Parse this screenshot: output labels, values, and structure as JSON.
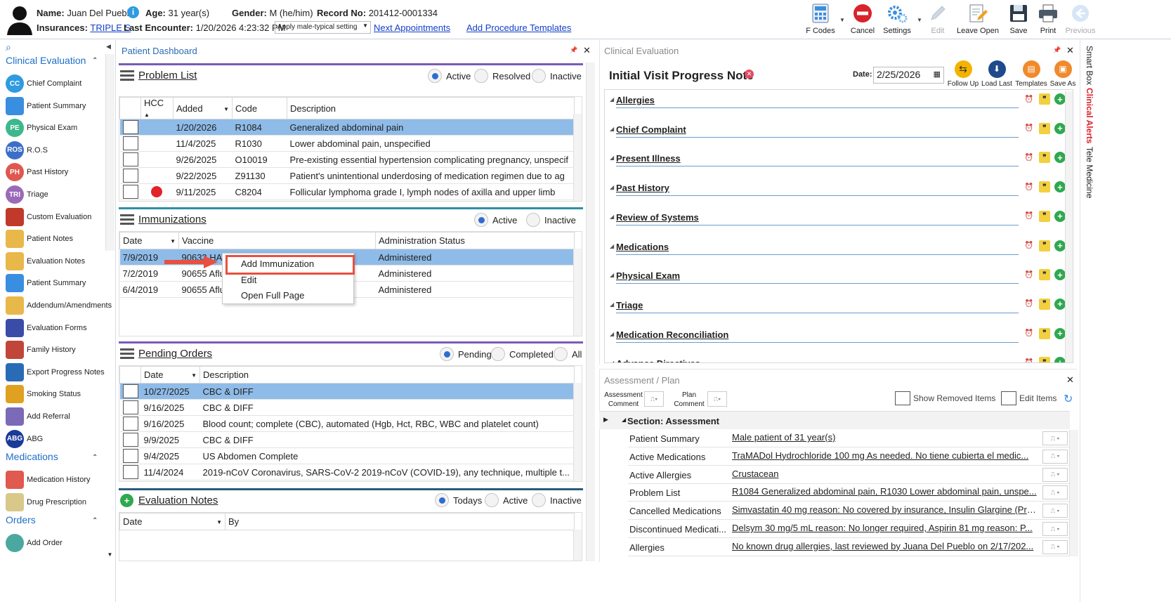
{
  "header": {
    "name_label": "Name:",
    "name_value": "Juan Del Pueblo",
    "age_label": "Age:",
    "age_value": "31 year(s)",
    "gender_label": "Gender:",
    "gender_value": "M (he/him)",
    "record_label": "Record No:",
    "record_value": "201412-0001334",
    "insurances_label": "Insurances:",
    "insurances_value": "TRIPLE S",
    "last_encounter_label": "Last Encounter:",
    "last_encounter_value": "1/20/2026 4:23:32 PM",
    "setting_select": "Apply male-typical setting",
    "next_appointments": "Next Appointments",
    "add_procedure_templates": "Add Procedure Templates"
  },
  "toolbar": {
    "fcodes": "F Codes",
    "cancel": "Cancel",
    "settings": "Settings",
    "edit": "Edit",
    "leave_open": "Leave Open",
    "save": "Save",
    "print": "Print",
    "previous": "Previous"
  },
  "nav": {
    "section_clinical": "Clinical Evaluation",
    "items_clinical": [
      {
        "label": "Chief Complaint",
        "badge": "CC"
      },
      {
        "label": "Patient Summary",
        "badge": ""
      },
      {
        "label": "Physical Exam",
        "badge": "PE"
      },
      {
        "label": "R.O.S",
        "badge": "ROS"
      },
      {
        "label": "Past History",
        "badge": "PH"
      },
      {
        "label": "Triage",
        "badge": "TRI"
      },
      {
        "label": "Custom Evaluation",
        "badge": ""
      },
      {
        "label": "Patient Notes",
        "badge": ""
      },
      {
        "label": "Evaluation Notes",
        "badge": ""
      },
      {
        "label": "Patient Summary",
        "badge": ""
      },
      {
        "label": "Addendum/Amendments",
        "badge": ""
      },
      {
        "label": "Evaluation Forms",
        "badge": ""
      },
      {
        "label": "Family History",
        "badge": ""
      },
      {
        "label": "Export Progress Notes",
        "badge": ""
      },
      {
        "label": "Smoking Status",
        "badge": ""
      },
      {
        "label": "Add Referral",
        "badge": ""
      },
      {
        "label": "ABG",
        "badge": "ABG"
      }
    ],
    "section_medications": "Medications",
    "items_medications": [
      {
        "label": "Medication History"
      },
      {
        "label": "Drug Prescription"
      }
    ],
    "section_orders": "Orders",
    "items_orders": [
      {
        "label": "Add Order"
      }
    ]
  },
  "dashboard": {
    "title": "Patient Dashboard",
    "problem_list": {
      "title": "Problem List",
      "filters": [
        "Active",
        "Resolved",
        "Inactive"
      ],
      "columns": [
        "HCC",
        "Added",
        "Code",
        "Description"
      ],
      "rows": [
        {
          "hcc": "",
          "added": "1/20/2026",
          "code": "R1084",
          "desc": "Generalized abdominal pain"
        },
        {
          "hcc": "",
          "added": "11/4/2025",
          "code": "R1030",
          "desc": "Lower abdominal pain, unspecified"
        },
        {
          "hcc": "",
          "added": "9/26/2025",
          "code": "O10019",
          "desc": "Pre-existing essential hypertension complicating pregnancy, unspecif"
        },
        {
          "hcc": "",
          "added": "9/22/2025",
          "code": "Z91130",
          "desc": "Patient's unintentional underdosing of medication regimen due to ag"
        },
        {
          "hcc": "red-dot",
          "added": "9/11/2025",
          "code": "C8204",
          "desc": "Follicular lymphoma grade I, lymph nodes of axilla and upper limb"
        }
      ]
    },
    "immunizations": {
      "title": "Immunizations",
      "filters": [
        "Active",
        "Inactive"
      ],
      "columns": [
        "Date",
        "Vaccine",
        "Administration Status"
      ],
      "rows": [
        {
          "date": "7/9/2019",
          "vaccine": "90633 HAV",
          "status": "Administered"
        },
        {
          "date": "7/2/2019",
          "vaccine": "90655 Aflu",
          "status": "Administered"
        },
        {
          "date": "6/4/2019",
          "vaccine": "90655 Aflu",
          "status": "Administered"
        }
      ]
    },
    "context_menu": [
      "Add Immunization",
      "Edit",
      "Open Full Page"
    ],
    "pending_orders": {
      "title": "Pending Orders",
      "filters": [
        "Pending",
        "Completed",
        "All"
      ],
      "columns": [
        "Date",
        "Description"
      ],
      "rows": [
        {
          "date": "10/27/2025",
          "desc": "CBC & DIFF"
        },
        {
          "date": "9/16/2025",
          "desc": "CBC & DIFF"
        },
        {
          "date": "9/16/2025",
          "desc": "Blood count; complete (CBC), automated (Hgb, Hct, RBC, WBC and platelet count)"
        },
        {
          "date": "9/9/2025",
          "desc": "CBC & DIFF"
        },
        {
          "date": "9/4/2025",
          "desc": "US Abdomen Complete"
        },
        {
          "date": "11/4/2024",
          "desc": "2019-nCoV Coronavirus, SARS-CoV-2 2019-nCoV (COVID-19), any technique, multiple t..."
        }
      ]
    },
    "evaluation_notes": {
      "title": "Evaluation Notes",
      "filters": [
        "Todays",
        "Active",
        "Inactive"
      ],
      "columns": [
        "Date",
        "By"
      ]
    }
  },
  "clinical_eval": {
    "title": "Clinical Evaluation",
    "note_title": "Initial Visit Progress Note",
    "date_label": "Date:",
    "date_value": "2/25/2026",
    "actions": [
      "Follow Up",
      "Load Last",
      "Templates",
      "Save As"
    ],
    "sections": [
      "Allergies",
      "Chief Complaint",
      "Present Illness",
      "Past History",
      "Review of Systems",
      "Medications",
      "Physical Exam",
      "Triage",
      "Medication Reconciliation",
      "Advance Directives"
    ]
  },
  "assessment": {
    "title": "Assessment / Plan",
    "assessment_comment": "Assessment Comment",
    "plan_comment": "Plan Comment",
    "show_removed": "Show Removed Items",
    "edit_items": "Edit Items",
    "section_label": "Section: Assessment",
    "rows": [
      {
        "k": "Patient Summary",
        "v": "Male patient of 31 year(s)"
      },
      {
        "k": "Active Medications",
        "v": "TraMADol Hydrochloride 100 mg As needed.  No tiene cubierta el medic..."
      },
      {
        "k": "Active Allergies",
        "v": "Crustacean"
      },
      {
        "k": "Problem List",
        "v": "R1084 Generalized abdominal pain, R1030 Lower abdominal pain, unspe..."
      },
      {
        "k": "Cancelled Medications",
        "v": "Simvastatin 40 mg reason: No covered by insurance, Insulin Glargine (Pre..."
      },
      {
        "k": "Discontinued Medicati...",
        "v": "Delsym 30 mg/5 mL reason: No longer required, Aspirin 81 mg reason: P..."
      },
      {
        "k": "Allergies",
        "v": "No known drug allergies, last reviewed by Juana Del Pueblo on 2/17/202..."
      }
    ]
  },
  "right_tabs": [
    "Smart Box",
    "Clinical Alerts",
    "Tele Medicine"
  ],
  "colors": {
    "accent": "#2a6bb5",
    "selected": "#8fbbe8",
    "alert": "#e0242a",
    "purple": "#7a5bb6",
    "teal": "#2e8fa8"
  }
}
